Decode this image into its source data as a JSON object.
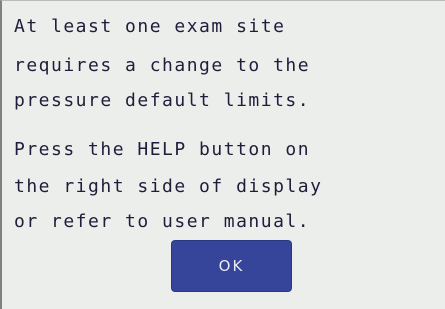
{
  "dialog": {
    "lines": [
      "At least one exam site",
      "requires a change to the",
      "pressure default limits.",
      "Press the HELP button on",
      "the right side of display",
      "or refer to user manual."
    ],
    "ok_label": "OK"
  },
  "colors": {
    "screen_background": "#eceeec",
    "text": "#1e1e3a",
    "button_background": "#36449a",
    "button_text": "#e8eaf5"
  }
}
